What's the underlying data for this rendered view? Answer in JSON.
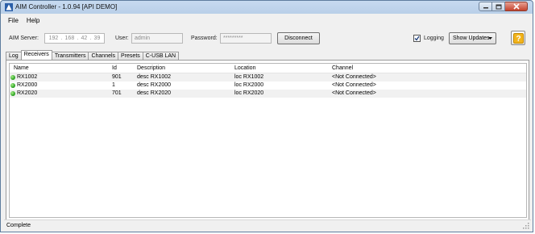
{
  "window": {
    "title": "AIM Controller - 1.0.94   [API DEMO]",
    "accent_color": "#c7daf0",
    "controls": [
      "minimize-icon",
      "maximize-icon",
      "close-icon"
    ]
  },
  "menu": {
    "items": [
      "File",
      "Help"
    ]
  },
  "toolbar": {
    "server_label": "AIM Server:",
    "ip": [
      "192",
      "168",
      "42",
      "39"
    ],
    "user_label": "User:",
    "user_value": "admin",
    "password_label": "Password:",
    "password_value": "*********",
    "disconnect_label": "Disconnect",
    "logging_label": "Logging",
    "logging_checked": true,
    "show_updates_label": "Show Updates",
    "help_icon": "help-icon"
  },
  "tabs": [
    "Log",
    "Receivers",
    "Transmitters",
    "Channels",
    "Presets",
    "C-USB LAN"
  ],
  "active_tab": "Receivers",
  "table": {
    "columns": [
      "Name",
      "Id",
      "Description",
      "Location",
      "Channel"
    ],
    "rows": [
      {
        "name": "RX1002",
        "id": "901",
        "description": "desc RX1002",
        "location": "loc RX1002",
        "channel": "<Not Connected>"
      },
      {
        "name": "RX2000",
        "id": "1",
        "description": "desc RX2000",
        "location": "loc RX2000",
        "channel": "<Not Connected>"
      },
      {
        "name": "RX2020",
        "id": "701",
        "description": "desc RX2020",
        "location": "loc RX2020",
        "channel": "<Not Connected>"
      }
    ],
    "status_color": "#2aa61f"
  },
  "status": {
    "text": "Complete"
  }
}
